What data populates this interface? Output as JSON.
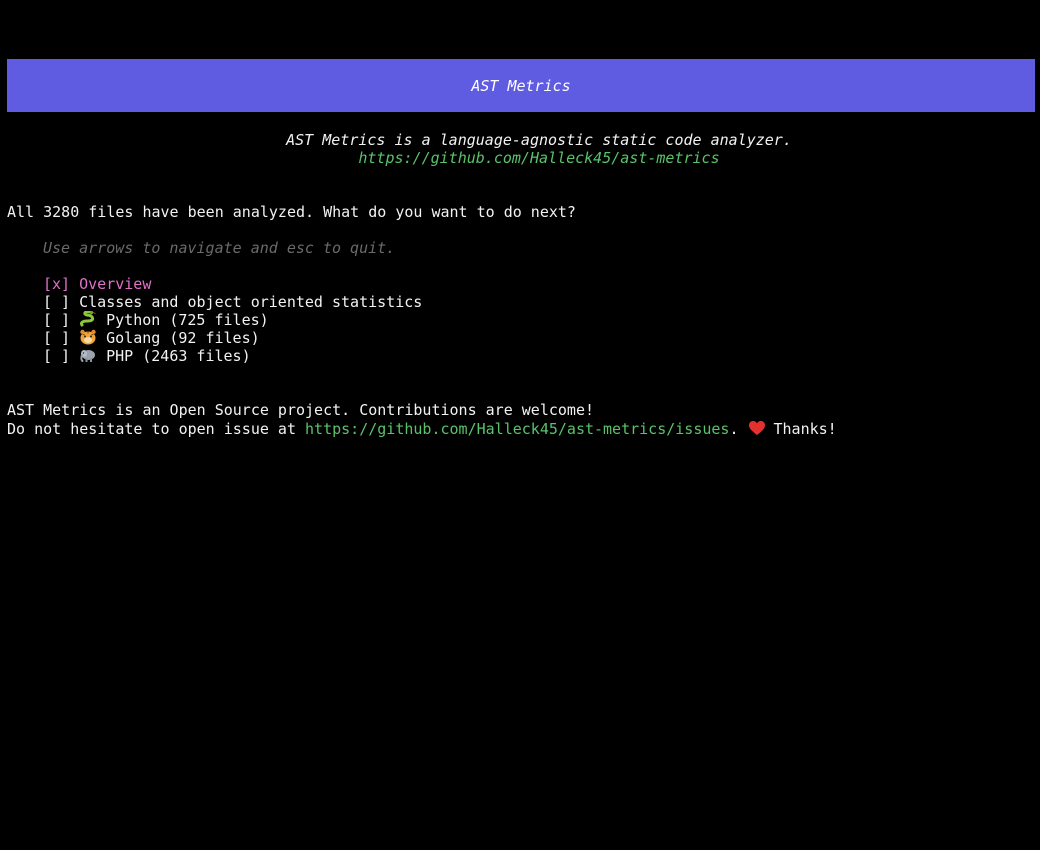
{
  "header": {
    "title": "AST Metrics",
    "color": "#5f5ce1"
  },
  "intro": {
    "tagline": "AST Metrics is a language-agnostic static code analyzer.",
    "repo_url": "https://github.com/Halleck45/ast-metrics"
  },
  "prompt": {
    "question": "All 3280 files have been analyzed. What do you want to do next?",
    "hint": "Use arrows to navigate and esc to quit."
  },
  "menu": {
    "items": [
      {
        "checkbox": "[x]",
        "label": "Overview",
        "selected": true,
        "icon": ""
      },
      {
        "checkbox": "[ ]",
        "label": "Classes and object oriented statistics",
        "selected": false,
        "icon": ""
      },
      {
        "checkbox": "[ ]",
        "label": "Python (725 files)",
        "selected": false,
        "icon": "snake-icon"
      },
      {
        "checkbox": "[ ]",
        "label": "Golang (92 files)",
        "selected": false,
        "icon": "gopher-icon"
      },
      {
        "checkbox": "[ ]",
        "label": "PHP (2463 files)",
        "selected": false,
        "icon": "elephant-icon"
      }
    ]
  },
  "footer": {
    "line1": "AST Metrics is an Open Source project. Contributions are welcome!",
    "line2_prefix": "Do not hesitate to open issue at ",
    "issues_url": "https://github.com/Halleck45/ast-metrics/issues",
    "line2_suffix": ".",
    "heart_icon": "heart-icon",
    "thanks": "Thanks!"
  },
  "colors": {
    "link": "#59c36a",
    "selected": "#e070c8",
    "hint": "#6a6a6a"
  }
}
